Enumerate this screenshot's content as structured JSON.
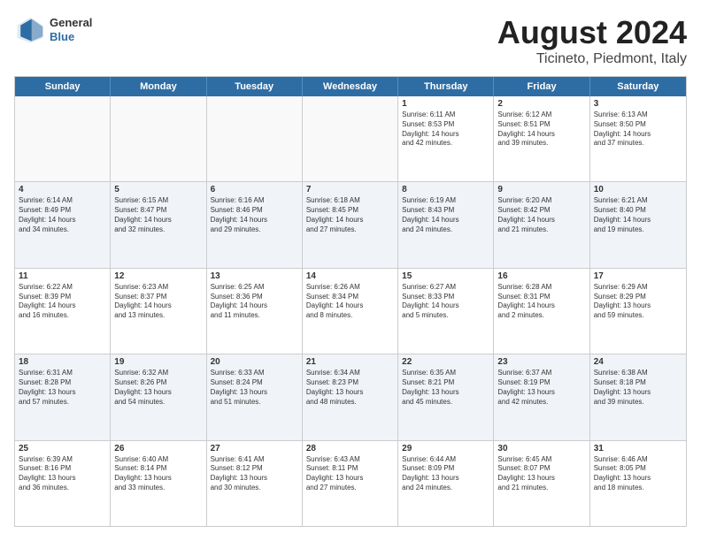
{
  "header": {
    "logo": {
      "general": "General",
      "blue": "Blue"
    },
    "title": "August 2024",
    "subtitle": "Ticineto, Piedmont, Italy"
  },
  "days": [
    "Sunday",
    "Monday",
    "Tuesday",
    "Wednesday",
    "Thursday",
    "Friday",
    "Saturday"
  ],
  "rows": [
    [
      {
        "day": "",
        "text": "",
        "empty": true
      },
      {
        "day": "",
        "text": "",
        "empty": true
      },
      {
        "day": "",
        "text": "",
        "empty": true
      },
      {
        "day": "",
        "text": "",
        "empty": true
      },
      {
        "day": "1",
        "text": "Sunrise: 6:11 AM\nSunset: 8:53 PM\nDaylight: 14 hours\nand 42 minutes."
      },
      {
        "day": "2",
        "text": "Sunrise: 6:12 AM\nSunset: 8:51 PM\nDaylight: 14 hours\nand 39 minutes."
      },
      {
        "day": "3",
        "text": "Sunrise: 6:13 AM\nSunset: 8:50 PM\nDaylight: 14 hours\nand 37 minutes."
      }
    ],
    [
      {
        "day": "4",
        "text": "Sunrise: 6:14 AM\nSunset: 8:49 PM\nDaylight: 14 hours\nand 34 minutes."
      },
      {
        "day": "5",
        "text": "Sunrise: 6:15 AM\nSunset: 8:47 PM\nDaylight: 14 hours\nand 32 minutes."
      },
      {
        "day": "6",
        "text": "Sunrise: 6:16 AM\nSunset: 8:46 PM\nDaylight: 14 hours\nand 29 minutes."
      },
      {
        "day": "7",
        "text": "Sunrise: 6:18 AM\nSunset: 8:45 PM\nDaylight: 14 hours\nand 27 minutes."
      },
      {
        "day": "8",
        "text": "Sunrise: 6:19 AM\nSunset: 8:43 PM\nDaylight: 14 hours\nand 24 minutes."
      },
      {
        "day": "9",
        "text": "Sunrise: 6:20 AM\nSunset: 8:42 PM\nDaylight: 14 hours\nand 21 minutes."
      },
      {
        "day": "10",
        "text": "Sunrise: 6:21 AM\nSunset: 8:40 PM\nDaylight: 14 hours\nand 19 minutes."
      }
    ],
    [
      {
        "day": "11",
        "text": "Sunrise: 6:22 AM\nSunset: 8:39 PM\nDaylight: 14 hours\nand 16 minutes."
      },
      {
        "day": "12",
        "text": "Sunrise: 6:23 AM\nSunset: 8:37 PM\nDaylight: 14 hours\nand 13 minutes."
      },
      {
        "day": "13",
        "text": "Sunrise: 6:25 AM\nSunset: 8:36 PM\nDaylight: 14 hours\nand 11 minutes."
      },
      {
        "day": "14",
        "text": "Sunrise: 6:26 AM\nSunset: 8:34 PM\nDaylight: 14 hours\nand 8 minutes."
      },
      {
        "day": "15",
        "text": "Sunrise: 6:27 AM\nSunset: 8:33 PM\nDaylight: 14 hours\nand 5 minutes."
      },
      {
        "day": "16",
        "text": "Sunrise: 6:28 AM\nSunset: 8:31 PM\nDaylight: 14 hours\nand 2 minutes."
      },
      {
        "day": "17",
        "text": "Sunrise: 6:29 AM\nSunset: 8:29 PM\nDaylight: 13 hours\nand 59 minutes."
      }
    ],
    [
      {
        "day": "18",
        "text": "Sunrise: 6:31 AM\nSunset: 8:28 PM\nDaylight: 13 hours\nand 57 minutes."
      },
      {
        "day": "19",
        "text": "Sunrise: 6:32 AM\nSunset: 8:26 PM\nDaylight: 13 hours\nand 54 minutes."
      },
      {
        "day": "20",
        "text": "Sunrise: 6:33 AM\nSunset: 8:24 PM\nDaylight: 13 hours\nand 51 minutes."
      },
      {
        "day": "21",
        "text": "Sunrise: 6:34 AM\nSunset: 8:23 PM\nDaylight: 13 hours\nand 48 minutes."
      },
      {
        "day": "22",
        "text": "Sunrise: 6:35 AM\nSunset: 8:21 PM\nDaylight: 13 hours\nand 45 minutes."
      },
      {
        "day": "23",
        "text": "Sunrise: 6:37 AM\nSunset: 8:19 PM\nDaylight: 13 hours\nand 42 minutes."
      },
      {
        "day": "24",
        "text": "Sunrise: 6:38 AM\nSunset: 8:18 PM\nDaylight: 13 hours\nand 39 minutes."
      }
    ],
    [
      {
        "day": "25",
        "text": "Sunrise: 6:39 AM\nSunset: 8:16 PM\nDaylight: 13 hours\nand 36 minutes."
      },
      {
        "day": "26",
        "text": "Sunrise: 6:40 AM\nSunset: 8:14 PM\nDaylight: 13 hours\nand 33 minutes."
      },
      {
        "day": "27",
        "text": "Sunrise: 6:41 AM\nSunset: 8:12 PM\nDaylight: 13 hours\nand 30 minutes."
      },
      {
        "day": "28",
        "text": "Sunrise: 6:43 AM\nSunset: 8:11 PM\nDaylight: 13 hours\nand 27 minutes."
      },
      {
        "day": "29",
        "text": "Sunrise: 6:44 AM\nSunset: 8:09 PM\nDaylight: 13 hours\nand 24 minutes."
      },
      {
        "day": "30",
        "text": "Sunrise: 6:45 AM\nSunset: 8:07 PM\nDaylight: 13 hours\nand 21 minutes."
      },
      {
        "day": "31",
        "text": "Sunrise: 6:46 AM\nSunset: 8:05 PM\nDaylight: 13 hours\nand 18 minutes."
      }
    ]
  ]
}
